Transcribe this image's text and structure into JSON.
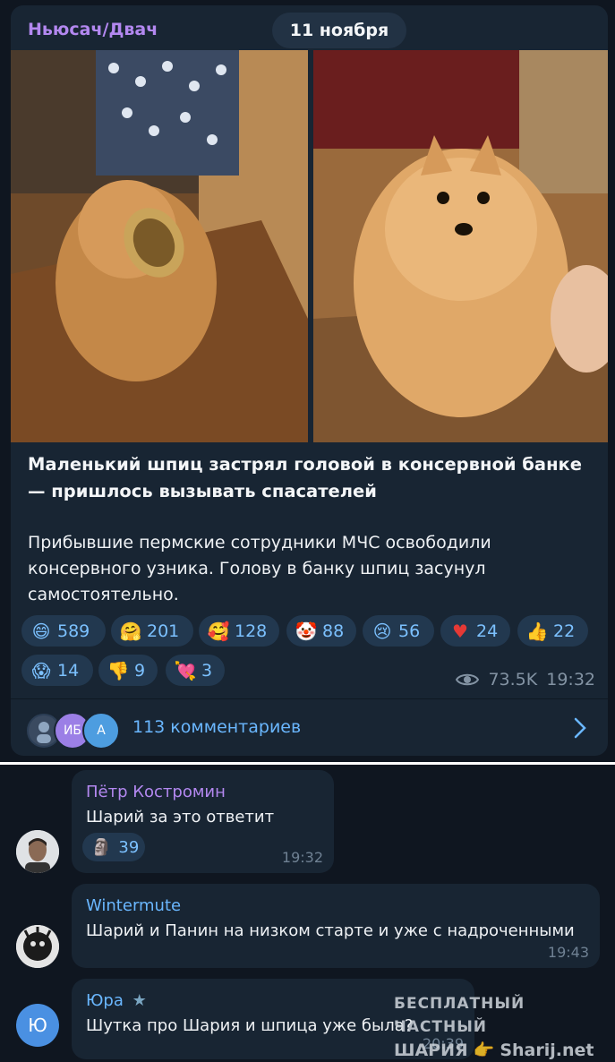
{
  "post": {
    "channel": "Ньюсач/Двач",
    "date": "11 ноября",
    "headline": "Маленький шпиц застрял головой в консервной банке — пришлось вызывать спасателей",
    "body": "Прибывшие пермские сотрудники МЧС освободили консервного узника. Голову в банку шпиц засунул самостоятельно.",
    "reactions": [
      {
        "icon": "grinning-face-icon",
        "count": "589"
      },
      {
        "icon": "hugging-face-icon",
        "count": "201"
      },
      {
        "icon": "smiling-face-hearts-icon",
        "count": "128"
      },
      {
        "icon": "clown-face-icon",
        "count": "88"
      },
      {
        "icon": "crying-face-icon",
        "count": "56"
      },
      {
        "icon": "red-heart-icon",
        "count": "24"
      },
      {
        "icon": "thumbs-up-icon",
        "count": "22"
      },
      {
        "icon": "screaming-face-icon",
        "count": "14"
      },
      {
        "icon": "thumbs-down-icon",
        "count": "9"
      },
      {
        "icon": "heart-arrow-icon",
        "count": "3"
      }
    ],
    "views": "73.5K",
    "time": "19:32",
    "comments_avatars": [
      "ИБ",
      "А"
    ],
    "comments_label": "113 комментариев"
  },
  "comments": [
    {
      "author": "Пётр Костромин",
      "author_color": "#b388f0",
      "text": "Шарий за это ответит",
      "reaction_icon": "moai-icon",
      "reaction_count": "39",
      "time": "19:32"
    },
    {
      "author": "Wintermute",
      "author_color": "#6ab7ff",
      "text": "Шарий и Панин на низком старте и уже с надроченными",
      "time": "19:43"
    },
    {
      "author": "Юра",
      "author_color": "#6ab7ff",
      "avatar_letter": "Ю",
      "text": "Шутка про Шария и шпица уже была?",
      "time": "20:39"
    }
  ],
  "watermark": {
    "line1": "БЕСПЛАТНЫЙ ЧАСТНЫЙ",
    "line2": "ШАРИЯ",
    "site": "Sharij.net"
  },
  "colors": {
    "background": "#0f1620",
    "bubble": "#182533",
    "accent": "#6ab7ff",
    "reaction_pill": "#22384f"
  }
}
